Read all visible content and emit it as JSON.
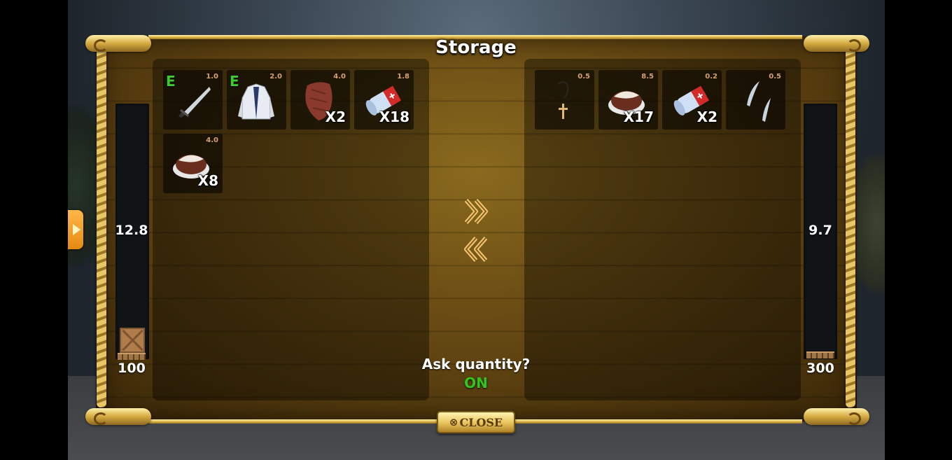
{
  "window": {
    "title": "Storage"
  },
  "left_inventory": {
    "weight": "12.8",
    "capacity": "100",
    "items": [
      {
        "name": "knife",
        "weight": "1.0",
        "equipped": "E",
        "qty": ""
      },
      {
        "name": "jacket",
        "weight": "2.0",
        "equipped": "E",
        "qty": ""
      },
      {
        "name": "leather",
        "weight": "4.0",
        "equipped": "",
        "qty": "X2"
      },
      {
        "name": "bandage",
        "weight": "1.8",
        "equipped": "",
        "qty": "X18"
      },
      {
        "name": "cooked-meat",
        "weight": "4.0",
        "equipped": "",
        "qty": "X8"
      }
    ]
  },
  "right_inventory": {
    "weight": "9.7",
    "capacity": "300",
    "items": [
      {
        "name": "rosary",
        "weight": "0.5",
        "equipped": "",
        "qty": ""
      },
      {
        "name": "cooked-meat",
        "weight": "8.5",
        "equipped": "",
        "qty": "X17"
      },
      {
        "name": "bandage",
        "weight": "0.2",
        "equipped": "",
        "qty": "X2"
      },
      {
        "name": "teeth",
        "weight": "0.5",
        "equipped": "",
        "qty": ""
      }
    ]
  },
  "ask_quantity": {
    "label": "Ask quantity?",
    "value": "ON"
  },
  "close_button": {
    "label": "CLOSE",
    "icon": "circle-x-icon"
  },
  "icons": {
    "move_right": "double-chevron-right-icon",
    "move_left": "double-chevron-left-icon",
    "side_tab": "play-arrow-icon"
  },
  "colors": {
    "equipped": "#3ecb2c",
    "on": "#34c41e",
    "weight_label": "#d8a070"
  }
}
